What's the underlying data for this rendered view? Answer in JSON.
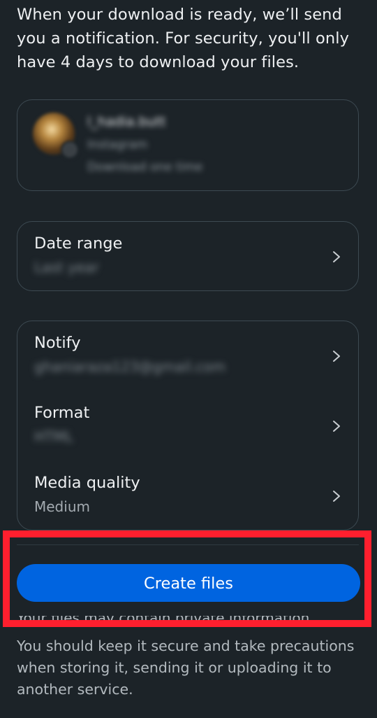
{
  "intro": {
    "text": "When your download is ready, we’ll send you a notification. For security, you'll only have 4 days to download your files."
  },
  "account": {
    "name": "l_hadia.butt",
    "source": "Instagram",
    "note": "Download one time"
  },
  "date_range": {
    "label": "Date range",
    "value": "Last year"
  },
  "settings": [
    {
      "label": "Notify",
      "value": "ghaniaraza123@gmail.com",
      "blurred": true
    },
    {
      "label": "Format",
      "value": "HTML",
      "blurred": true
    },
    {
      "label": "Media quality",
      "value": "Medium",
      "blurred": false
    }
  ],
  "actions": {
    "create_files": "Create files"
  },
  "footer": {
    "partial_line": "Your files may contain private information.",
    "text": "You should keep it secure and take precautions when storing it, sending it or uploading it to another service."
  },
  "colors": {
    "background": "#1c2328",
    "card_border": "#3d4a52",
    "primary_button": "#0064e0",
    "highlight": "#ff1f2e"
  },
  "icons": {
    "chevron": "chevron-right-icon"
  }
}
